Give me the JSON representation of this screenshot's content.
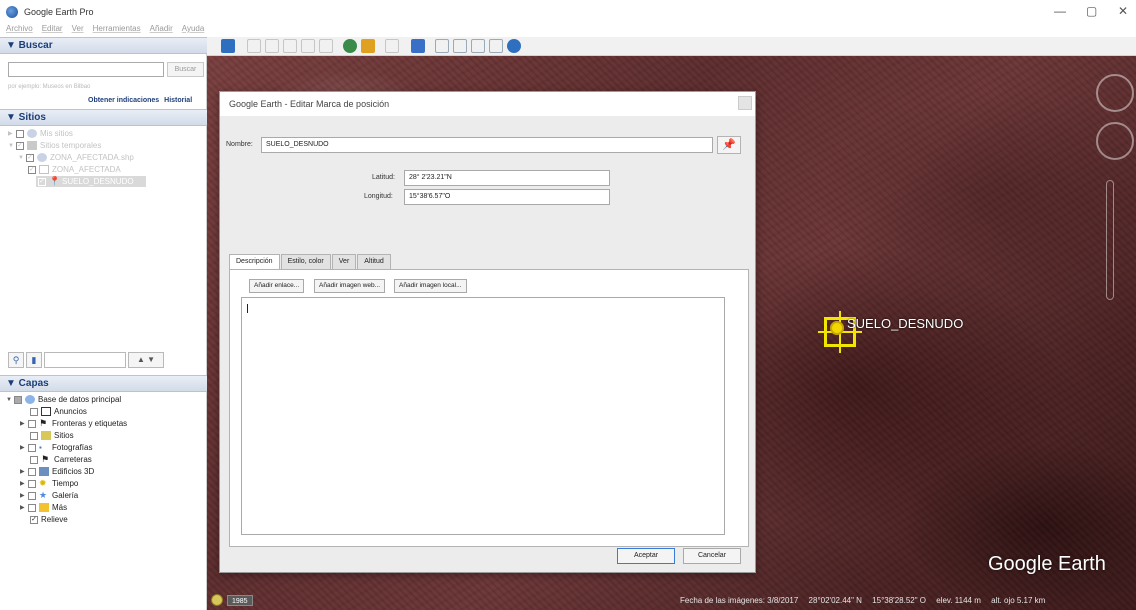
{
  "window": {
    "title": "Google Earth Pro",
    "controls": {
      "minimize": "—",
      "maximize": "▢",
      "close": "✕"
    }
  },
  "menu": [
    "Archivo",
    "Editar",
    "Ver",
    "Herramientas",
    "Añadir",
    "Ayuda"
  ],
  "search": {
    "header": "▼ Buscar",
    "input_value": "",
    "button": "Buscar",
    "hint": "por ejemplo: Museos en Bilbao",
    "link_directions": "Obtener indicaciones",
    "link_history": "Historial"
  },
  "places": {
    "header": "▼ Sitios",
    "items": [
      {
        "label": "Mis sitios",
        "faded": true
      },
      {
        "label": "Sitios temporales",
        "faded": true
      },
      {
        "label": "ZONA_AFECTADA.shp",
        "faded": true
      },
      {
        "label": "ZONA_AFECTADA",
        "faded": true
      },
      {
        "label": "SUELO_DESNUDO",
        "selected": true
      }
    ]
  },
  "layers": {
    "header": "▼ Capas",
    "root": "Base de datos principal",
    "items": [
      {
        "label": "Anuncios",
        "checked": false
      },
      {
        "label": "Fronteras y etiquetas",
        "checked": false
      },
      {
        "label": "Sitios",
        "checked": false
      },
      {
        "label": "Fotografías",
        "checked": false
      },
      {
        "label": "Carreteras",
        "checked": false
      },
      {
        "label": "Edificios 3D",
        "checked": false
      },
      {
        "label": "Tiempo",
        "checked": false
      },
      {
        "label": "Galería",
        "checked": false
      },
      {
        "label": "Más",
        "checked": false
      },
      {
        "label": "Relieve",
        "checked": true
      }
    ]
  },
  "dialog": {
    "title": "Google Earth - Editar Marca de posición",
    "name_label": "Nombre:",
    "name_value": "SUELO_DESNUDO",
    "lat_label": "Latitud:",
    "lat_value": "28° 2'23.21\"N",
    "lon_label": "Longitud:",
    "lon_value": "15°38'6.57\"O",
    "tabs": [
      "Descripción",
      "Estilo, color",
      "Ver",
      "Altitud"
    ],
    "active_tab": "Descripción",
    "btn_add_link": "Añadir enlace...",
    "btn_add_web_image": "Añadir imagen web...",
    "btn_add_local_image": "Añadir imagen local...",
    "description_value": "",
    "btn_accept": "Aceptar",
    "btn_cancel": "Cancelar"
  },
  "map": {
    "placemark_label": "SUELO_DESNUDO",
    "logo": "Google Earth",
    "history_year": "1985",
    "status": {
      "imagery_date": "Fecha de las imágenes: 3/8/2017",
      "lat": "28°02'02.44\" N",
      "lon": "15°38'28.52\" O",
      "elev": "elev.  1144 m",
      "eye_alt": "alt. ojo  5.17 km"
    }
  },
  "colors": {
    "placemark": "#f2e600",
    "header_text": "#1b3e79",
    "map_base": "#5e2d2e"
  }
}
